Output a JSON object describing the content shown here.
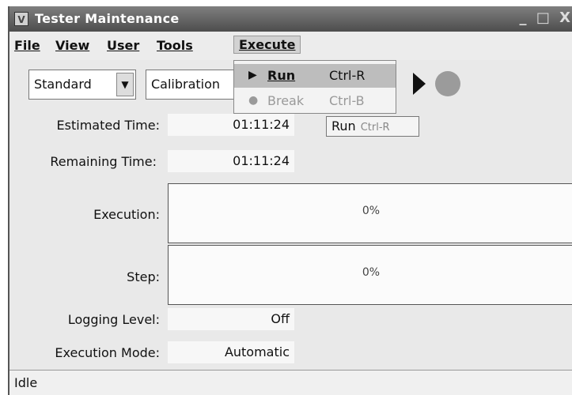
{
  "window": {
    "title": "Tester Maintenance",
    "controls": [
      "_",
      "□",
      "X"
    ]
  },
  "menubar": {
    "file": "File",
    "view": "View",
    "user": "User",
    "tools": "Tools",
    "execute": "Execute"
  },
  "toolbar": {
    "mode_combo": "Standard",
    "procedure_combo": "Calibration",
    "play_icon": "play-icon",
    "stop_icon": "stop-icon"
  },
  "execute_menu": {
    "items": [
      {
        "label": "Run",
        "accelerator": "Ctrl-R",
        "icon": "run-icon"
      },
      {
        "label": "Break",
        "accelerator": "Ctrl-B",
        "icon": "break-icon"
      }
    ]
  },
  "tooltip": {
    "label": "Run",
    "accelerator": "Ctrl-R"
  },
  "fields": {
    "estimated_time": {
      "label": "Estimated Time:",
      "value": "01:11:24"
    },
    "remaining_time": {
      "label": "Remaining Time:",
      "value": "01:11:24"
    },
    "execution": {
      "label": "Execution:",
      "text": "0%",
      "progress": 0
    },
    "step": {
      "label": "Step:",
      "text": "0%",
      "progress": 0
    },
    "logging_level": {
      "label": "Logging Level:",
      "value": "Off"
    },
    "execution_mode": {
      "label": "Execution Mode:",
      "value": "Automatic"
    }
  },
  "status": {
    "text": "Idle"
  }
}
